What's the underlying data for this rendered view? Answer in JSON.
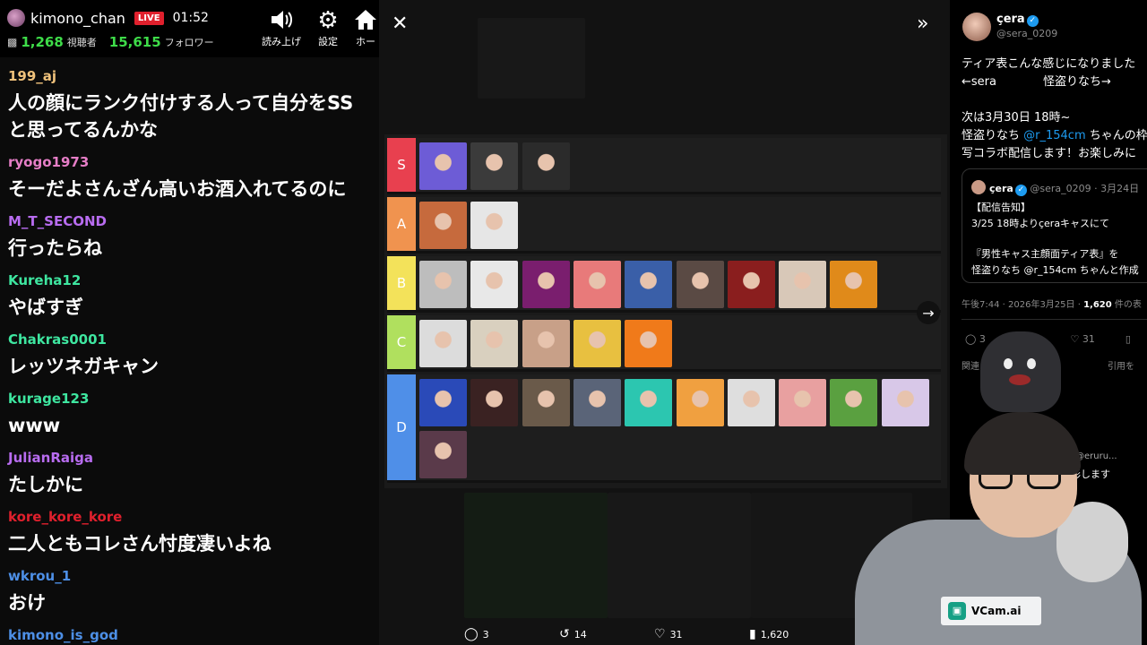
{
  "stream": {
    "streamer": "kimono_chan",
    "live_badge": "LIVE",
    "elapsed": "01:52",
    "viewers": "1,268",
    "viewers_unit": "視聴者",
    "followers": "15,615",
    "followers_unit": "フォロワー",
    "buttons": [
      {
        "label": "読み上げ",
        "icon": "speaker-icon"
      },
      {
        "label": "設定",
        "icon": "gear-icon"
      },
      {
        "label": "ホー",
        "icon": "home-icon"
      }
    ]
  },
  "chat": [
    {
      "user": "199_aj",
      "color": "#f0c27b",
      "text": "人の顔にランク付けする人って自分をSS"
    },
    {
      "user": "",
      "color": "#ffffff",
      "text": "と思ってるんかな"
    },
    {
      "user": "ryogo1973",
      "color": "#e67ec7",
      "text": "そーだよさんざん高いお酒入れてるのに"
    },
    {
      "user": "M_T_SECOND",
      "color": "#b86cf0",
      "text": "行ったらね"
    },
    {
      "user": "Kureha12",
      "color": "#3ee6a0",
      "text": "やばすぎ"
    },
    {
      "user": "Chakras0001",
      "color": "#3ee6a0",
      "text": "レッツネガキャン"
    },
    {
      "user": "kurage123",
      "color": "#3ee6a0",
      "text": "www"
    },
    {
      "user": "JulianRaiga",
      "color": "#b86cf0",
      "text": "たしかに"
    },
    {
      "user": "kore_kore_kore",
      "color": "#e0202d",
      "text": "二人ともコレさん忖度凄いよね"
    },
    {
      "user": "wkrou_1",
      "color": "#4d8fe6",
      "text": "おけ"
    },
    {
      "user": "kimono_is_god",
      "color": "#4d8fe6",
      "text": ""
    }
  ],
  "browser": {
    "close_icon": "close-icon",
    "expand_icon": "chevron-double-right-icon",
    "bottom_bar": [
      {
        "icon": "reply-icon",
        "count": "3"
      },
      {
        "icon": "retweet-icon",
        "count": "14"
      },
      {
        "icon": "like-icon",
        "count": "31"
      },
      {
        "icon": "views-icon",
        "count": "1,620"
      }
    ]
  },
  "tier_list": {
    "tiers": [
      {
        "label": "S",
        "color": "#e8404f",
        "count": 3
      },
      {
        "label": "A",
        "color": "#f0934f",
        "count": 2
      },
      {
        "label": "B",
        "color": "#f3e25a",
        "count": 9
      },
      {
        "label": "C",
        "color": "#b0e05e",
        "count": 5
      },
      {
        "label": "D",
        "color": "#4f8fe8",
        "count": 11
      }
    ]
  },
  "tweet": {
    "name": "çera",
    "handle": "@sera_0209",
    "lines": [
      "ティア表こんな感じになりました",
      "←sera　　　　怪盗りなち→",
      "",
      "次は3月30日 18時~",
      "怪盗りなち @r_154cm ちゃんの枠",
      "写コラボ配信します！お楽しみに"
    ],
    "quote": {
      "name": "çera",
      "handle": "@sera_0209 · 3月24日",
      "lines": [
        "【配信告知】",
        "3/25 18時よりçeraキャスにて",
        "",
        "『男性キャス主顔面ティア表』を",
        "怪盗りなち @r_154cm ちゃんと作成"
      ]
    },
    "meta_time": "午後7:44 · 2026年3月25日 · ",
    "meta_views": "1,620",
    "meta_suffix": " 件の表",
    "actions": [
      {
        "icon": "reply-icon",
        "count": "3"
      },
      {
        "icon": "retweet-icon",
        "count": "14"
      },
      {
        "icon": "like-icon",
        "count": "31"
      },
      {
        "icon": "bookmark-icon",
        "count": ""
      }
    ],
    "related_left": "関連",
    "related_right": "引用を",
    "reply_handle": "@eruru...",
    "reply_text": "整形します"
  },
  "overlay": {
    "vcam_label": "VCam.ai"
  }
}
